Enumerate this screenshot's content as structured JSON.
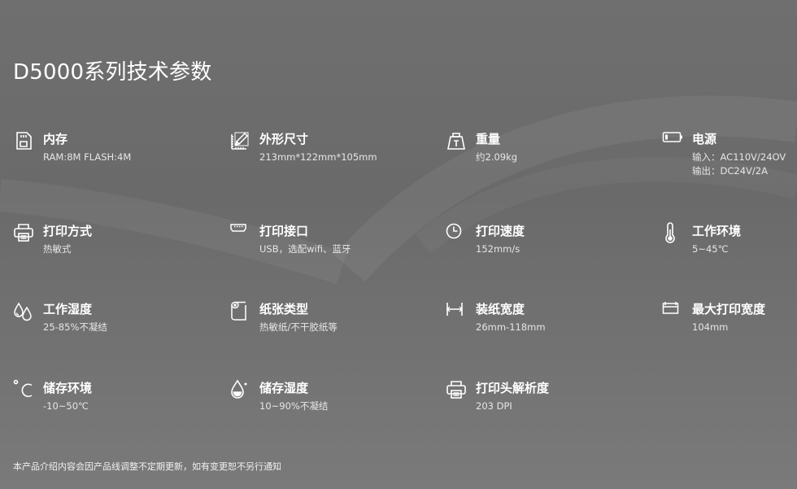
{
  "title": "D5000系列技术参数",
  "specs": [
    {
      "icon": "sd-card-icon",
      "label": "内存",
      "value": "RAM:8M FLASH:4M"
    },
    {
      "icon": "ruler-pencil-icon",
      "label": "外形尺寸",
      "value": "213mm*122mm*105mm"
    },
    {
      "icon": "weight-icon",
      "label": "重量",
      "value": "约2.09kg"
    },
    {
      "icon": "battery-icon",
      "label": "电源",
      "value": "输入：AC110V/24OV",
      "value2": "输出：DC24V/2A"
    },
    {
      "icon": "printer-icon",
      "label": "打印方式",
      "value": "热敏式"
    },
    {
      "icon": "usb-port-icon",
      "label": "打印接口",
      "value": "USB，选配wifi、蓝牙"
    },
    {
      "icon": "clock-icon",
      "label": "打印速度",
      "value": "152mm/s"
    },
    {
      "icon": "thermometer-icon",
      "label": "工作环境",
      "value": "5~45℃"
    },
    {
      "icon": "droplets-icon",
      "label": "工作湿度",
      "value": "25-85%不凝结"
    },
    {
      "icon": "paper-roll-icon",
      "label": "纸张类型",
      "value": "热敏纸/不干胶纸等"
    },
    {
      "icon": "paper-width-icon",
      "label": "装纸宽度",
      "value": "26mm-118mm"
    },
    {
      "icon": "print-width-icon",
      "label": "最大打印宽度",
      "value": "104mm"
    },
    {
      "icon": "celsius-icon",
      "label": "储存环境",
      "value": "-10~50℃"
    },
    {
      "icon": "humidity-drop-icon",
      "label": "储存湿度",
      "value": "10~90%不凝结"
    },
    {
      "icon": "printer-icon",
      "label": "打印头解析度",
      "value": "203 DPI"
    }
  ],
  "footer": "本产品介绍内容会因产品线调整不定期更新，如有变更恕不另行通知"
}
